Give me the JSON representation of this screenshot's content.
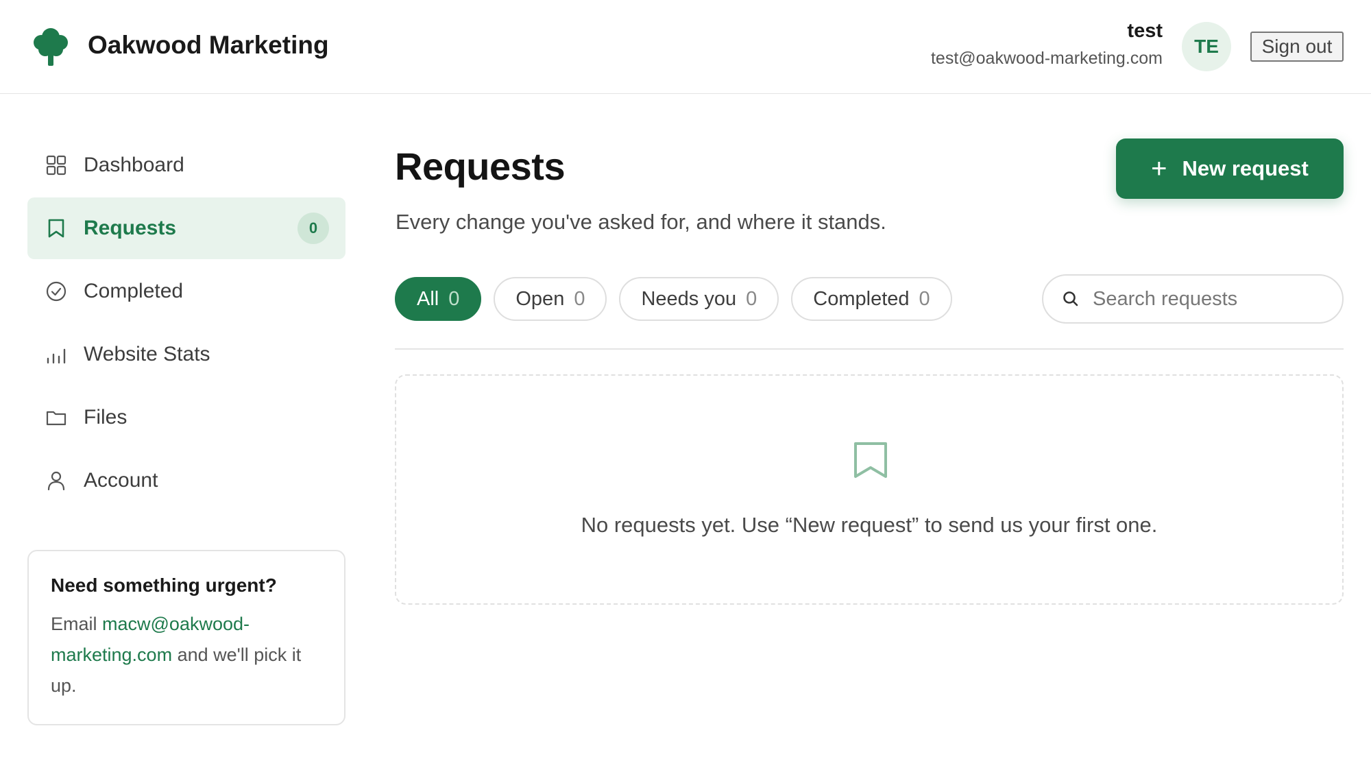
{
  "header": {
    "brand_name": "Oakwood Marketing",
    "user_name": "test",
    "user_email": "test@oakwood-marketing.com",
    "avatar_initials": "TE",
    "signout_label": "Sign out"
  },
  "sidebar": {
    "items": [
      {
        "label": "Dashboard",
        "icon": "grid-icon"
      },
      {
        "label": "Requests",
        "icon": "bookmark-icon",
        "badge": "0",
        "active": true
      },
      {
        "label": "Completed",
        "icon": "check-circle-icon"
      },
      {
        "label": "Website Stats",
        "icon": "bar-chart-icon"
      },
      {
        "label": "Files",
        "icon": "folder-icon"
      },
      {
        "label": "Account",
        "icon": "user-icon"
      }
    ],
    "urgent": {
      "title": "Need something urgent?",
      "text_before": "Email ",
      "email": "macw@oakwood-marketing.com",
      "text_after": " and we'll pick it up."
    }
  },
  "main": {
    "title": "Requests",
    "subtitle": "Every change you've asked for, and where it stands.",
    "new_button_label": "New request",
    "filters": [
      {
        "label": "All",
        "count": "0",
        "active": true
      },
      {
        "label": "Open",
        "count": "0"
      },
      {
        "label": "Needs you",
        "count": "0"
      },
      {
        "label": "Completed",
        "count": "0"
      }
    ],
    "search_placeholder": "Search requests",
    "empty_message": "No requests yet. Use “New request” to send us your first one."
  },
  "colors": {
    "accent": "#1e7a4c",
    "accent_light": "#e8f3ec",
    "border": "#e4e4e4"
  }
}
